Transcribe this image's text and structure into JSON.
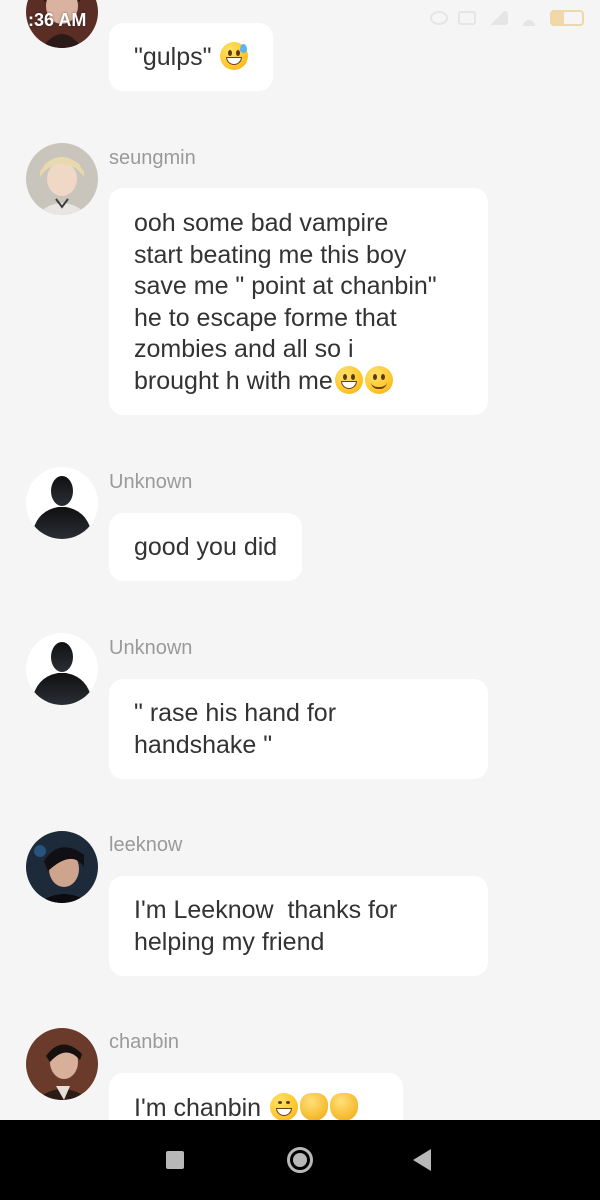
{
  "status_bar": {
    "time": ":36 AM"
  },
  "messages": [
    {
      "sender": "",
      "text": "\"gulps\" ",
      "emojis": [
        "sweat-smile-emoji"
      ],
      "avatar": "avatar-photo-top"
    },
    {
      "sender": "seungmin",
      "text": "ooh some bad vampire\nstart beating me this boy\nsave me \" point at chanbin\"\nhe to escape forme that\nzombies and all so i\nbrought h with me",
      "emojis": [
        "grin-emoji",
        "smile-emoji"
      ],
      "avatar": "avatar-photo-seungmin"
    },
    {
      "sender": "Unknown",
      "text": "good you did",
      "emojis": [],
      "avatar": "avatar-silhouette"
    },
    {
      "sender": "Unknown",
      "text": "\" rase his hand for\nhandshake \"",
      "emojis": [],
      "avatar": "avatar-silhouette"
    },
    {
      "sender": "leeknow",
      "text": "I'm Leeknow  thanks for\nhelping my friend",
      "emojis": [],
      "avatar": "avatar-photo-leeknow"
    },
    {
      "sender": "chanbin",
      "text": "I'm chanbin ",
      "emojis": [
        "laughing-emoji",
        "handshake-emoji",
        "handshake-emoji"
      ],
      "avatar": "avatar-photo-chanbin"
    }
  ],
  "colors": {
    "background": "#f5f5f5",
    "bubble": "#ffffff",
    "sender_text": "#9a9a9a",
    "message_text": "#333333",
    "nav_bar": "#000000"
  }
}
